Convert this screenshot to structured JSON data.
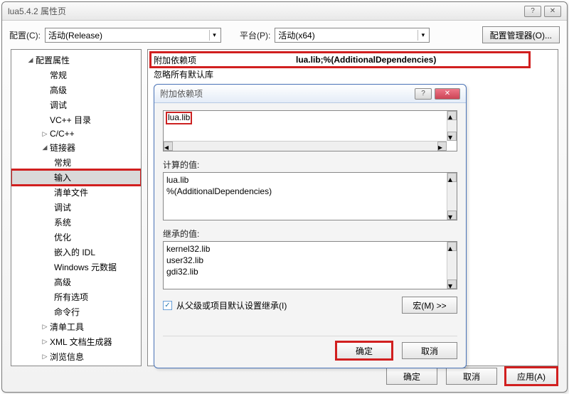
{
  "main_window": {
    "title": "lua5.4.2 属性页",
    "config_label": "配置(C):",
    "config_value": "活动(Release)",
    "platform_label": "平台(P):",
    "platform_value": "活动(x64)",
    "config_manager_btn": "配置管理器(O)...",
    "buttons": {
      "ok": "确定",
      "cancel": "取消",
      "apply": "应用(A)"
    }
  },
  "tree": {
    "n0": "配置属性",
    "n1": "常规",
    "n2": "高级",
    "n3": "调试",
    "n4": "VC++ 目录",
    "n5": "C/C++",
    "n6": "链接器",
    "n6_0": "常规",
    "n6_1": "输入",
    "n6_2": "清单文件",
    "n6_3": "调试",
    "n6_4": "系统",
    "n6_5": "优化",
    "n6_6": "嵌入的 IDL",
    "n6_7": "Windows 元数据",
    "n6_8": "高级",
    "n6_9": "所有选项",
    "n6_10": "命令行",
    "n7": "清单工具",
    "n8": "XML 文档生成器",
    "n9": "浏览信息"
  },
  "right_panel": {
    "row0_label": "附加依赖项",
    "row0_value": "lua.lib;%(AdditionalDependencies)",
    "row1_label": "忽略所有默认库"
  },
  "modal": {
    "title": "附加依赖项",
    "input_value": "lua.lib",
    "computed_label": "计算的值:",
    "computed_0": "lua.lib",
    "computed_1": "%(AdditionalDependencies)",
    "inherited_label": "继承的值:",
    "inherited_0": "kernel32.lib",
    "inherited_1": "user32.lib",
    "inherited_2": "gdi32.lib",
    "inherit_checkbox": "从父级或项目默认设置继承(I)",
    "macro_btn": "宏(M) >>",
    "ok": "确定",
    "cancel": "取消"
  }
}
